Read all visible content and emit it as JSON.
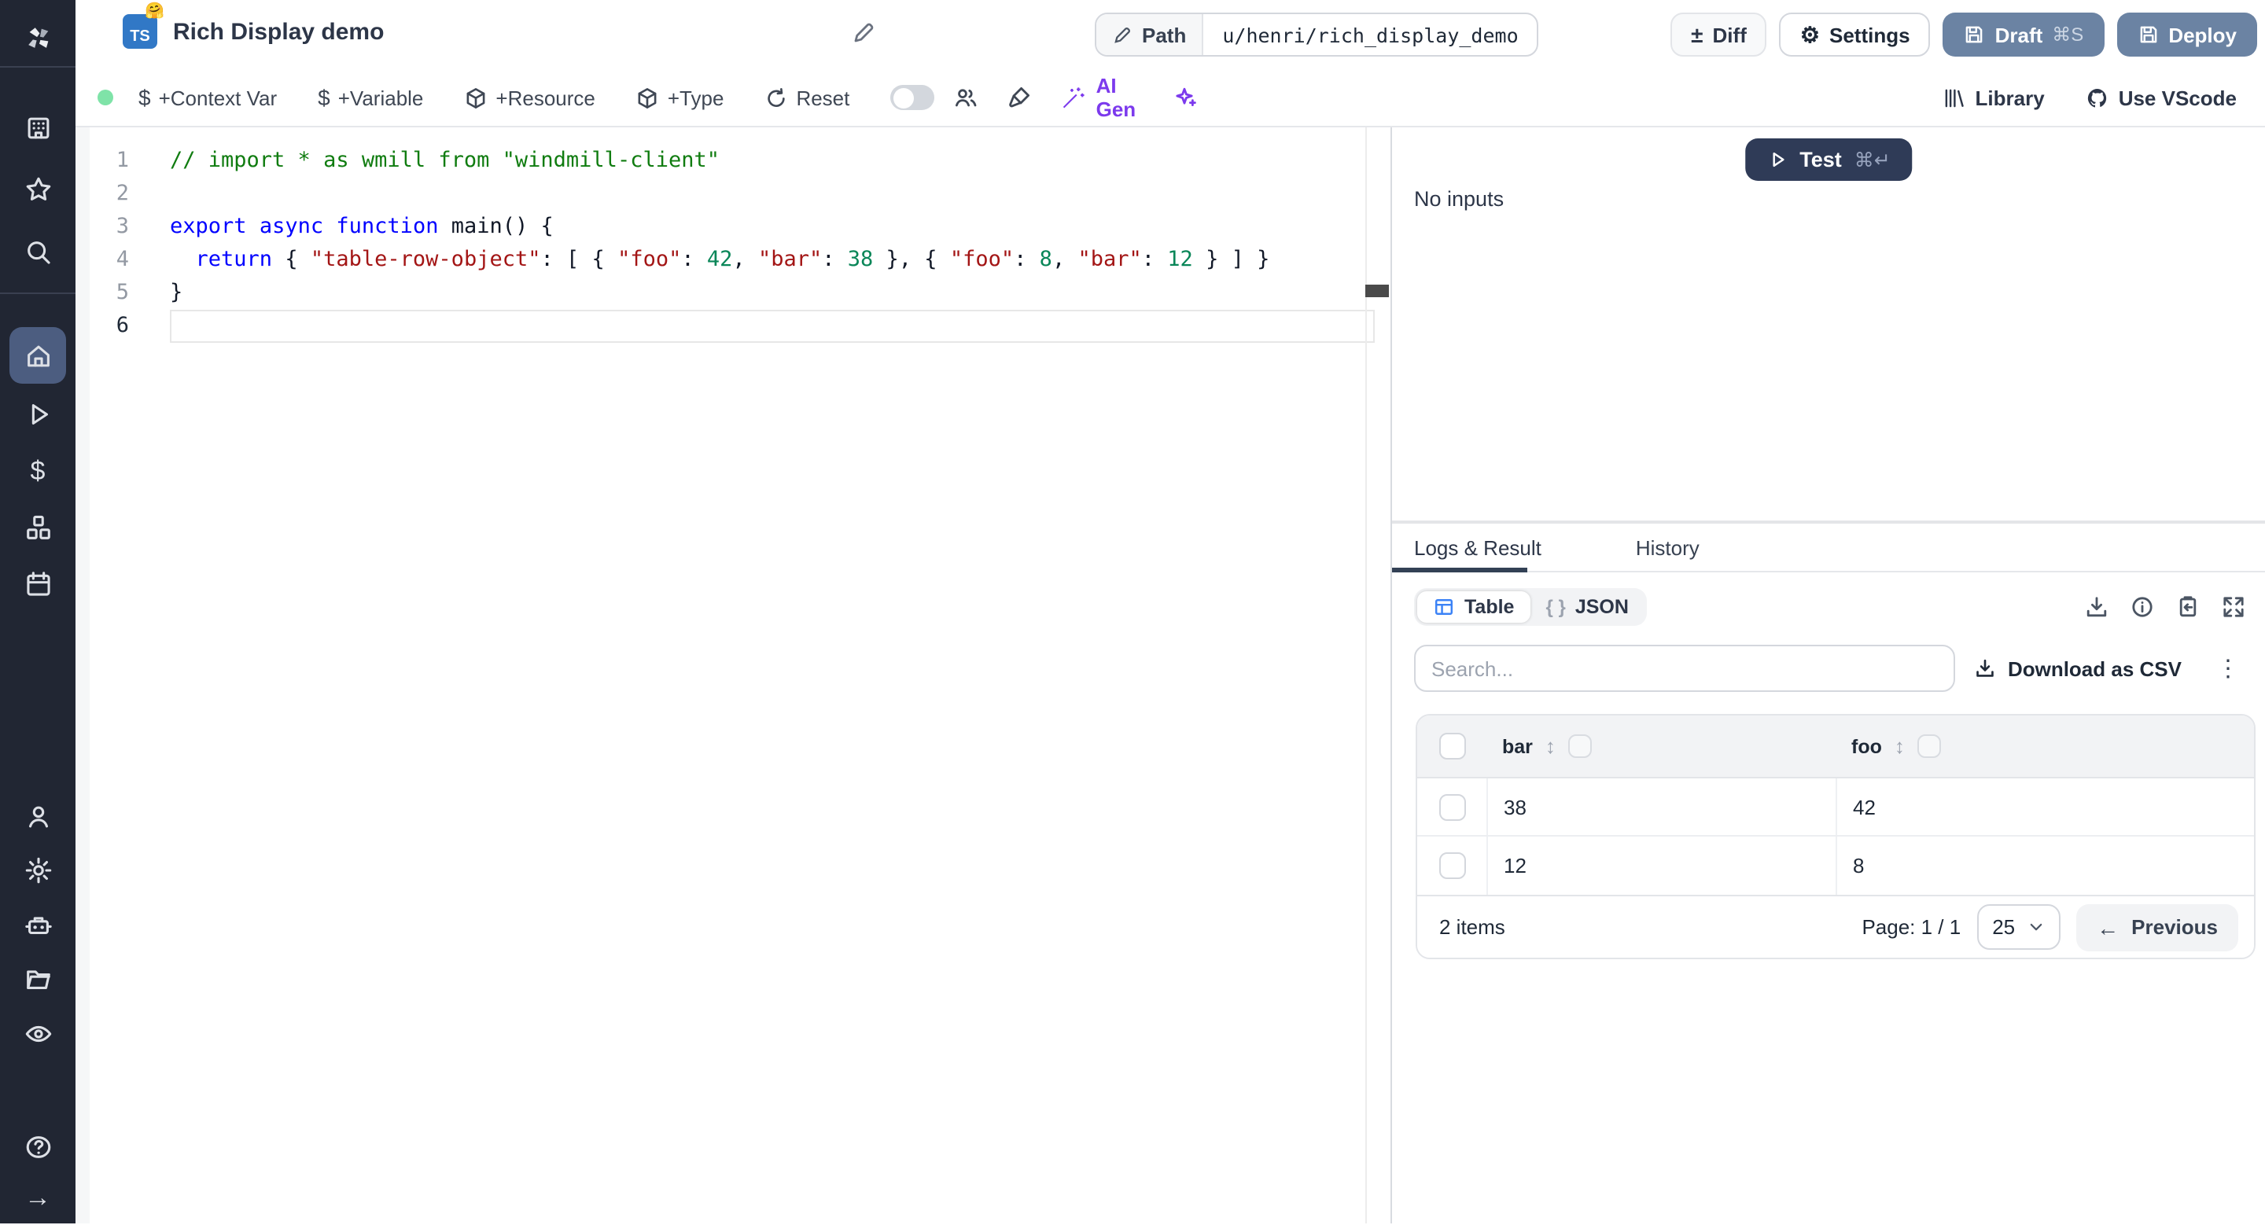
{
  "colors": {
    "sidebar_bg": "#212633",
    "sidebar_active": "#4c5d80",
    "primary_button": "#6b83a3",
    "test_button": "#2f3b57",
    "ts_badge_blue": "#3178c6",
    "ai_purple": "#7c3aed",
    "status_green": "#7fe3a8",
    "table_icon_blue": "#3b82f6"
  },
  "sidebar": {
    "active": "home-icon",
    "icons": [
      "windmill-logo",
      "workspace-icon",
      "favorites-icon",
      "search-icon",
      "home-icon",
      "runs-icon",
      "variables-icon",
      "resources-icon",
      "schedules-icon",
      "user-icon",
      "settings-icon",
      "workers-icon",
      "folders-icon",
      "audit-logs-icon",
      "help-icon",
      "collapse-icon"
    ]
  },
  "header": {
    "title": "Rich Display demo",
    "language_badge": "TS",
    "badge_emoji": "🤗",
    "path_label": "Path",
    "path_value": "u/henri/rich_display_demo",
    "diff_label": "Diff",
    "diff_glyph": "±",
    "settings_label": "Settings",
    "settings_glyph": "⚙",
    "draft_label": "Draft",
    "draft_shortcut": "⌘S",
    "deploy_label": "Deploy"
  },
  "toolbar": {
    "items": [
      "+Context Var",
      "+Variable",
      "+Resource",
      "+Type",
      "Reset"
    ],
    "dollar_glyph": "$",
    "ai_gen_label": "AI Gen",
    "library_label": "Library",
    "use_vscode_label": "Use VScode"
  },
  "editor": {
    "lines": [
      {
        "num": "1",
        "tokens": [
          {
            "c": "comment",
            "s": "// import * as wmill from \"windmill-client\""
          }
        ]
      },
      {
        "num": "2",
        "tokens": []
      },
      {
        "num": "3",
        "tokens": [
          {
            "c": "kw",
            "s": "export"
          },
          {
            "c": "plain",
            "s": " "
          },
          {
            "c": "kw",
            "s": "async"
          },
          {
            "c": "plain",
            "s": " "
          },
          {
            "c": "kw",
            "s": "function"
          },
          {
            "c": "plain",
            "s": " "
          },
          {
            "c": "fn",
            "s": "main"
          },
          {
            "c": "plain",
            "s": "() {"
          }
        ]
      },
      {
        "num": "4",
        "tokens": [
          {
            "c": "plain",
            "s": "  "
          },
          {
            "c": "kw",
            "s": "return"
          },
          {
            "c": "plain",
            "s": " { "
          },
          {
            "c": "str",
            "s": "\"table-row-object\""
          },
          {
            "c": "plain",
            "s": ": [ { "
          },
          {
            "c": "str",
            "s": "\"foo\""
          },
          {
            "c": "plain",
            "s": ": "
          },
          {
            "c": "num",
            "s": "42"
          },
          {
            "c": "plain",
            "s": ", "
          },
          {
            "c": "str",
            "s": "\"bar\""
          },
          {
            "c": "plain",
            "s": ": "
          },
          {
            "c": "num",
            "s": "38"
          },
          {
            "c": "plain",
            "s": " }, { "
          },
          {
            "c": "str",
            "s": "\"foo\""
          },
          {
            "c": "plain",
            "s": ": "
          },
          {
            "c": "num",
            "s": "8"
          },
          {
            "c": "plain",
            "s": ", "
          },
          {
            "c": "str",
            "s": "\"bar\""
          },
          {
            "c": "plain",
            "s": ": "
          },
          {
            "c": "num",
            "s": "12"
          },
          {
            "c": "plain",
            "s": " } ] }"
          }
        ]
      },
      {
        "num": "5",
        "tokens": [
          {
            "c": "plain",
            "s": "}"
          }
        ]
      },
      {
        "num": "6",
        "tokens": [],
        "current": true
      }
    ]
  },
  "run_panel": {
    "test_label": "Test",
    "test_shortcut": "⌘↵",
    "no_inputs": "No inputs"
  },
  "result_panel": {
    "tabs": {
      "logs_result": "Logs & Result",
      "history": "History"
    },
    "view_toggle": {
      "table": "Table",
      "json": "JSON",
      "json_braces": "{ }"
    },
    "action_icons": [
      "download-icon",
      "info-icon",
      "copy-icon",
      "expand-icon"
    ],
    "search_placeholder": "Search...",
    "download_csv_label": "Download as CSV",
    "kebab_glyph": "⋮",
    "table": {
      "columns": [
        "bar",
        "foo"
      ],
      "sort_glyph": "↕",
      "rows": [
        [
          "38",
          "42"
        ],
        [
          "12",
          "8"
        ]
      ],
      "items_label": "2 items",
      "page_label": "Page: 1 / 1",
      "page_size": "25",
      "prev_label": "Previous",
      "prev_arrow": "←"
    }
  }
}
